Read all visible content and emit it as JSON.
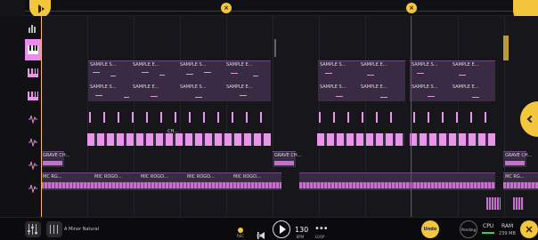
{
  "transport": {
    "tempo": "130",
    "tempo_label": "BPM",
    "rec_label": "REC",
    "prev_label": "REC",
    "loop_label": "LOOP",
    "undo": "Undo",
    "pending": "Pending"
  },
  "project": {
    "scale": "A Minor Natural"
  },
  "stats": {
    "cpu_label": "CPU",
    "ram_label": "RAM",
    "ram_value": "239 MB"
  },
  "clips": {
    "sample": "SAMPLE S...",
    "sample_e": "SAMPLE E...",
    "sample_s": "SAMPLE S...",
    "grave": "GRAVE CH...",
    "mic": "MIC ROGO...",
    "mic_short": "MC RG...",
    "ch": "CH..."
  },
  "colors": {
    "accent": "#f3c63c",
    "clip": "#e896ea",
    "active_track": "#ee8aee"
  }
}
